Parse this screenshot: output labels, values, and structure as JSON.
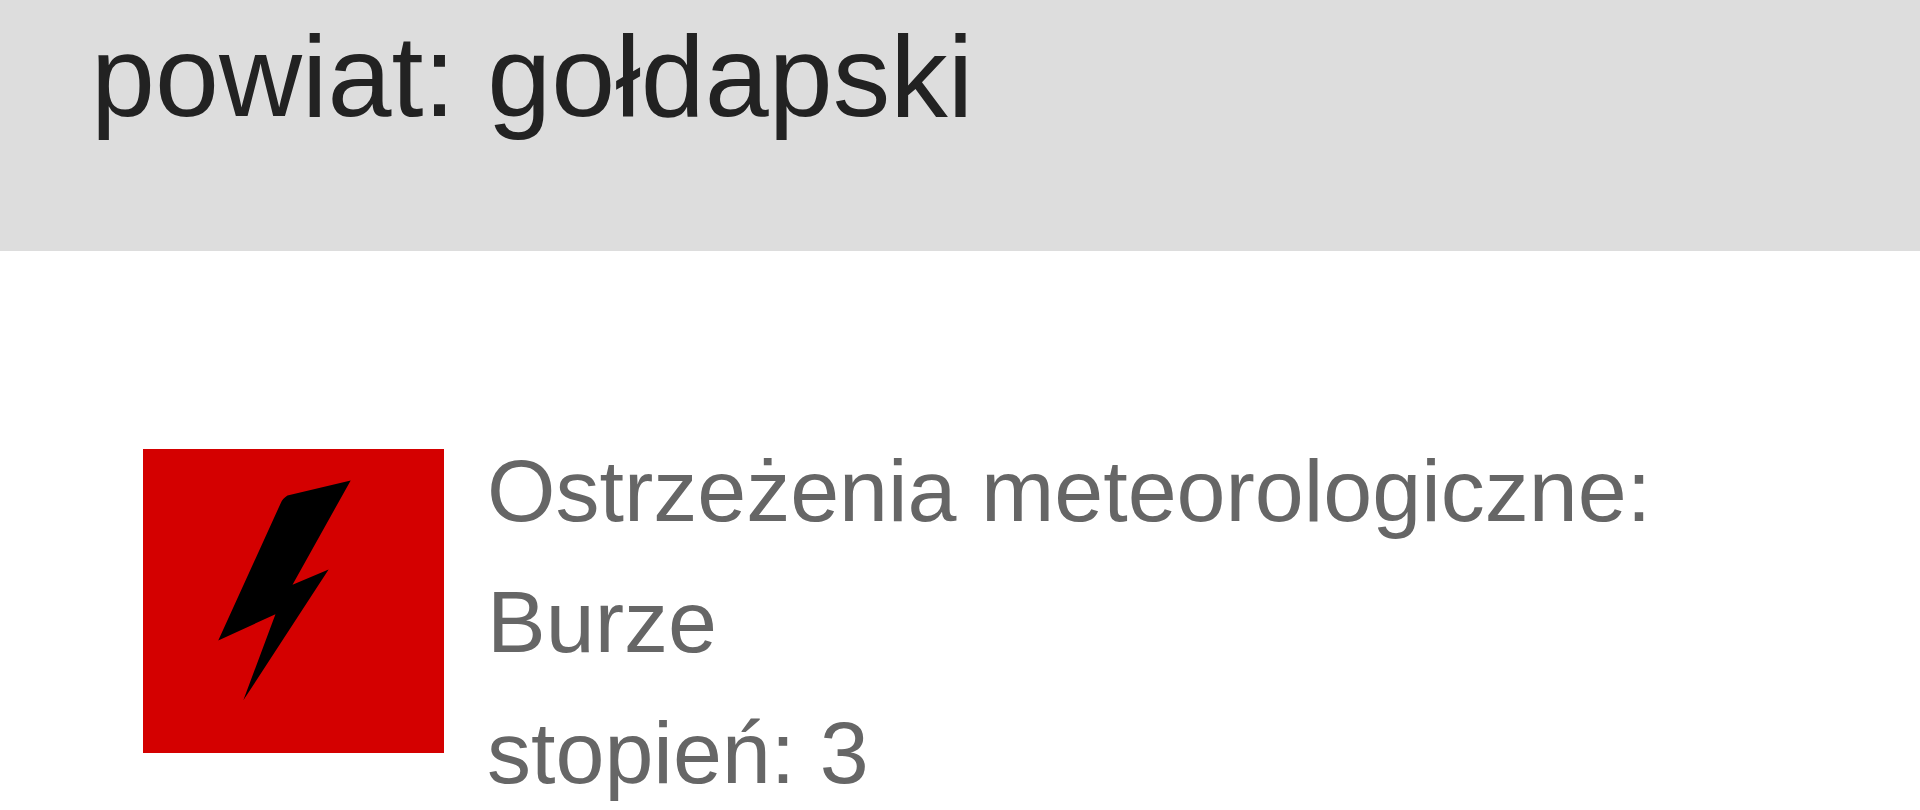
{
  "header": {
    "title": "powiat: gołdapski"
  },
  "warnings": [
    {
      "kind": "storm",
      "color": "#d40000",
      "category": "Ostrzeżenia meteorologiczne:",
      "phenomenon": "Burze",
      "degree": "stopień: 3"
    }
  ]
}
